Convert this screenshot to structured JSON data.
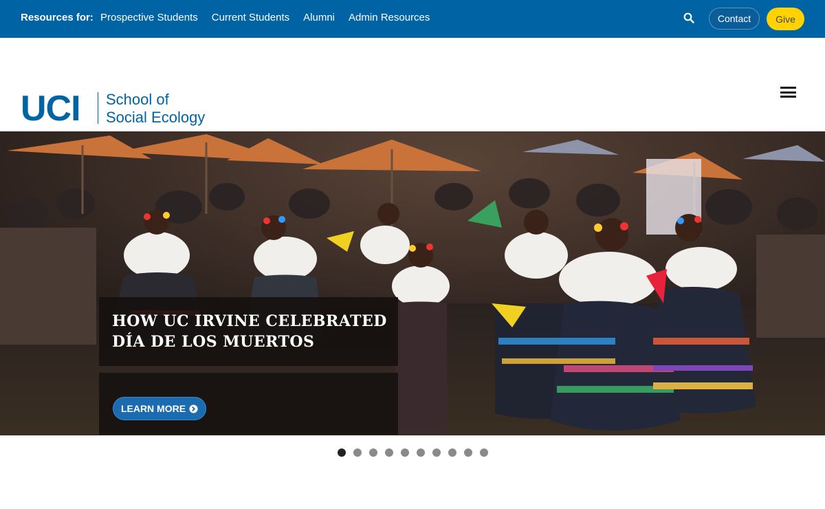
{
  "topbar": {
    "resources_label": "Resources for:",
    "links": [
      "Prospective Students",
      "Current Students",
      "Alumni",
      "Admin Resources"
    ],
    "contact_label": "Contact",
    "give_label": "Give",
    "colors": {
      "bar": "#0064a4",
      "give": "#ffd200"
    }
  },
  "header": {
    "logo_uci": "UCI",
    "logo_line1": "School of",
    "logo_line2": "Social Ecology"
  },
  "hero": {
    "headline_line1": "HOW UC IRVINE CELEBRATED",
    "headline_line2": "DÍA DE LOS MUERTOS",
    "cta_label": "LEARN MORE",
    "slide_count": 10,
    "active_slide": 1
  }
}
